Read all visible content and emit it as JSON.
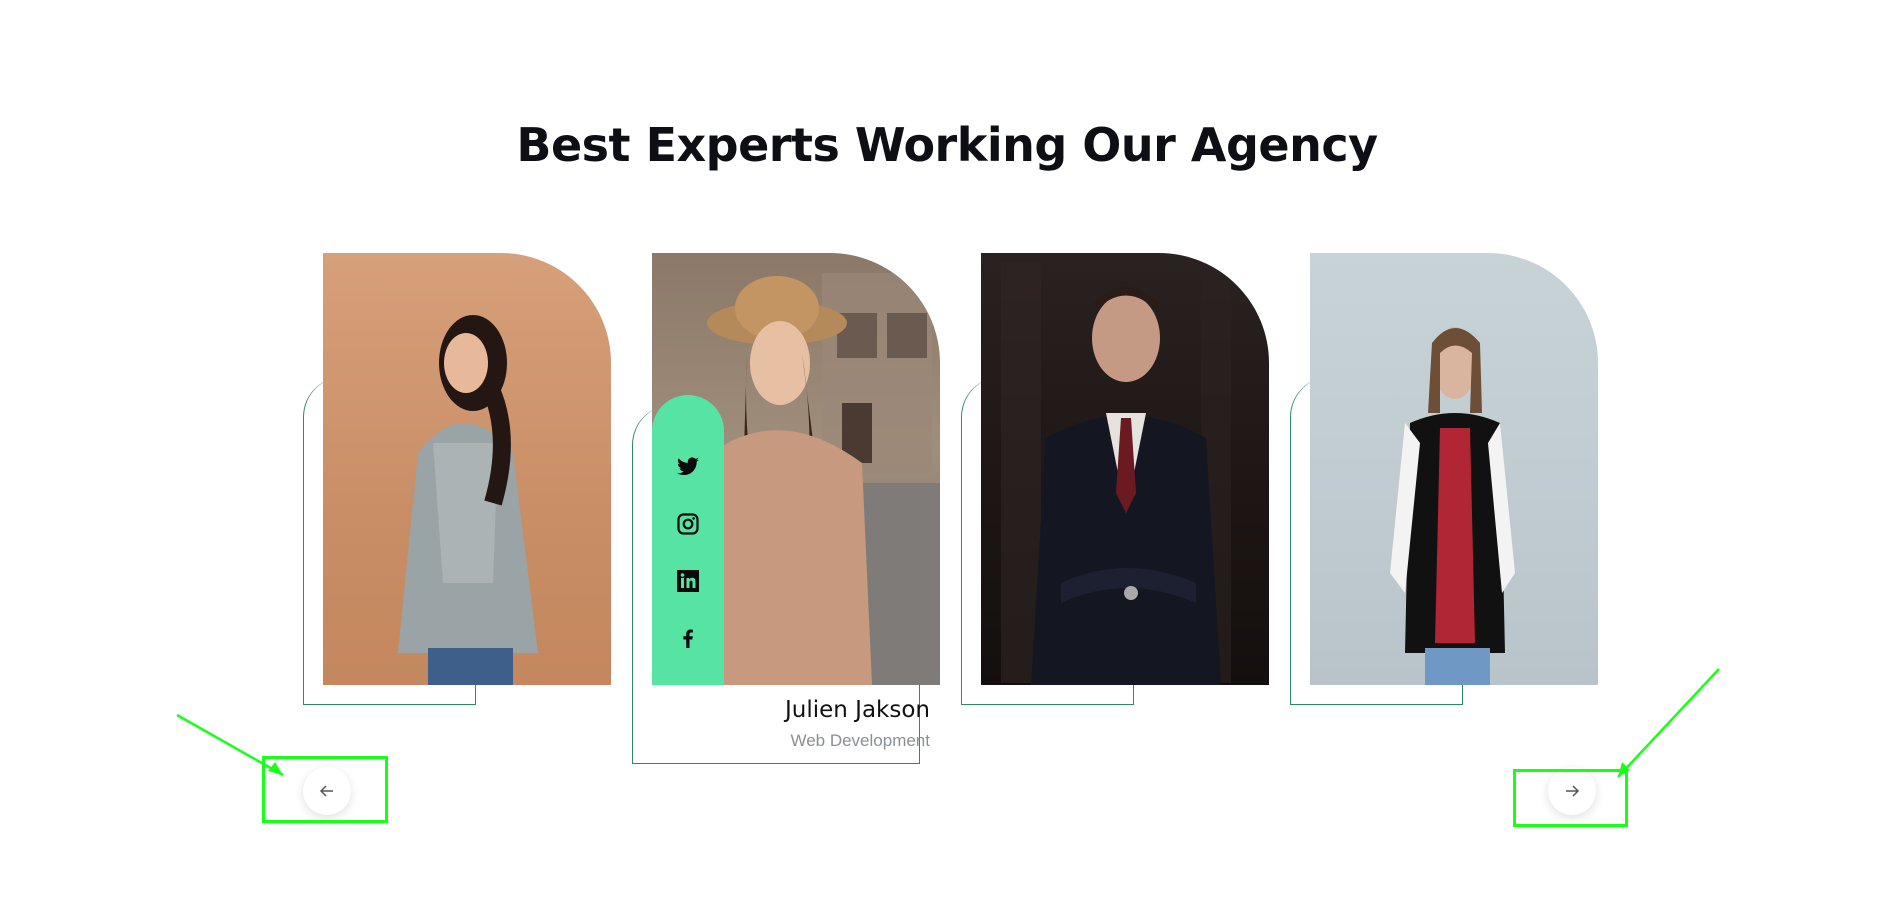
{
  "section": {
    "title": "Best Experts Working Our Agency"
  },
  "team": [
    {
      "id": "member-1"
    },
    {
      "id": "member-2",
      "name": "Julien Jakson",
      "role": "Web Development",
      "social": [
        "twitter-icon",
        "instagram-icon",
        "linkedin-icon",
        "facebook-icon"
      ]
    },
    {
      "id": "member-3"
    },
    {
      "id": "member-4"
    }
  ],
  "nav": {
    "prev_icon": "arrow-left-icon",
    "next_icon": "arrow-right-icon"
  },
  "colors": {
    "accent": "#57e3a3",
    "frame": "#2c8a66",
    "highlight": "#1aff1a"
  }
}
